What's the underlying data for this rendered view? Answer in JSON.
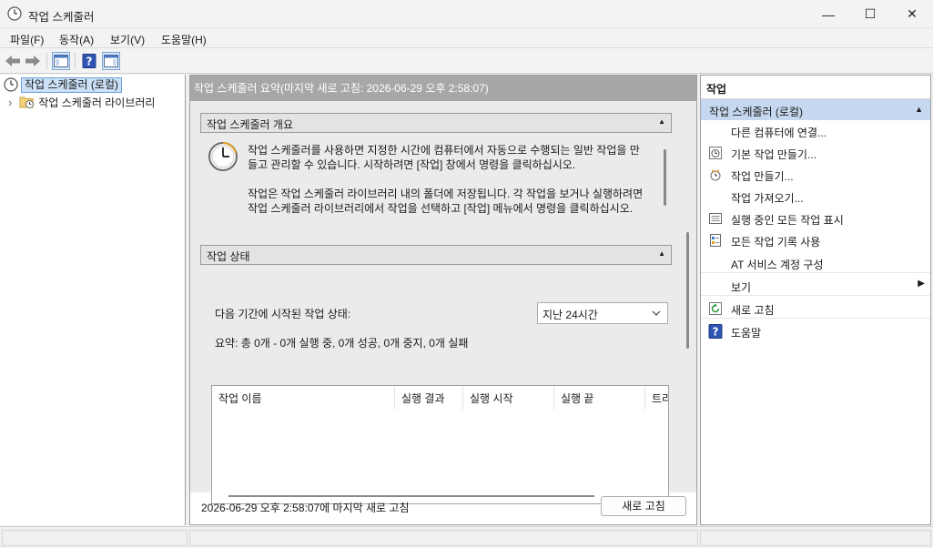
{
  "window": {
    "title": "작업 스케줄러",
    "controls": {
      "minimize": "—",
      "maximize": "☐",
      "close": "✕"
    },
    "icon": "clock-icon"
  },
  "menu": [
    "파일(F)",
    "동작(A)",
    "보기(V)",
    "도움말(H)"
  ],
  "toolbar": {
    "buttons": [
      "back-arrow-icon",
      "forward-arrow-icon",
      "show-hide-console-tree-icon",
      "help-icon",
      "show-hide-action-pane-icon"
    ]
  },
  "tree": {
    "root": "작업 스케줄러 (로컬)",
    "child": "작업 스케줄러 라이브러리",
    "child_expander": "›"
  },
  "center": {
    "header": "작업 스케줄러 요약(마지막 새로 고침: 2026-06-29 오후 2:58:07)",
    "overview": {
      "title": "작업 스케줄러 개요",
      "paragraph1": "작업 스케줄러를 사용하면 지정한 시간에 컴퓨터에서 자동으로 수행되는 일반 작업을 만들고 관리할 수 있습니다. 시작하려면 [작업] 창에서 명령을 클릭하십시오.",
      "paragraph2": "작업은 작업 스케줄러 라이브러리 내의 폴더에 저장됩니다. 각 작업을 보거나 실행하려면 작업 스케줄러 라이브러리에서 작업을 선택하고 [작업] 메뉴에서 명령을 클릭하십시오."
    },
    "status": {
      "title": "작업 상태",
      "period_label": "다음 기간에 시작된 작업 상태:",
      "period_value": "지난 24시간",
      "summary": "요약: 총 0개 - 0개 실행 중, 0개 성공, 0개 중지, 0개 실패",
      "columns": [
        "작업 이름",
        "실행 결과",
        "실행 시작",
        "실행 끝",
        "트리"
      ]
    },
    "footer": {
      "last_refresh": "2026-06-29 오후 2:58:07에 마지막 새로 고침",
      "refresh_button": "새로 고침"
    }
  },
  "actions": {
    "header": "작업",
    "group": "작업 스케줄러 (로컬)",
    "items": [
      {
        "label": "다른 컴퓨터에 연결...",
        "icon": ""
      },
      {
        "label": "기본 작업 만들기...",
        "icon": "create-basic-task-icon"
      },
      {
        "label": "작업 만들기...",
        "icon": "create-task-icon"
      },
      {
        "label": "작업 가져오기...",
        "icon": ""
      },
      {
        "label": "실행 중인 모든 작업 표시",
        "icon": "running-tasks-icon"
      },
      {
        "label": "모든 작업 기록 사용",
        "icon": "task-history-icon"
      },
      {
        "label": "AT 서비스 계정 구성",
        "icon": ""
      },
      {
        "label": "보기",
        "icon": "",
        "submenu": "▶"
      },
      {
        "label": "새로 고침",
        "icon": "refresh-icon"
      },
      {
        "label": "도움말",
        "icon": "help-icon"
      }
    ]
  }
}
